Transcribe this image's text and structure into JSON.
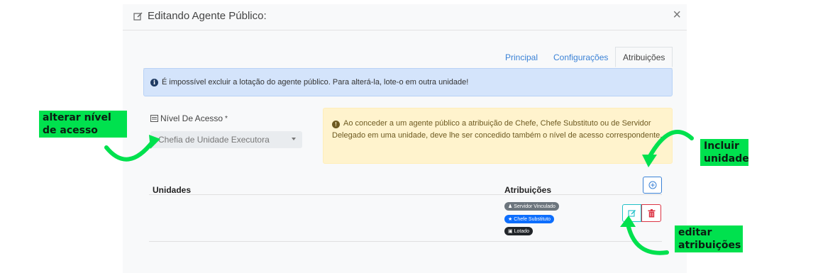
{
  "modal": {
    "title": "Editando Agente Público:",
    "close_icon": "×"
  },
  "tabs": [
    {
      "label": "Principal",
      "active": false
    },
    {
      "label": "Configurações",
      "active": false
    },
    {
      "label": "Atribuições",
      "active": true
    }
  ],
  "info_alert": {
    "icon": "info-circle-icon",
    "text": "É impossível excluir a lotação do agente público. Para alterá-la, lote-o em outra unidade!"
  },
  "access_level": {
    "label": "Nível De Acesso",
    "required_mark": "*",
    "selected_value": "Chefia de Unidade Executora"
  },
  "warning_alert": {
    "icon": "exclamation-circle-icon",
    "text": "Ao conceder a um agente público a atribuição de Chefe, Chefe Substituto ou de Servidor Delegado em uma unidade, deve lhe ser concedido também o nível de acesso correspondente."
  },
  "table": {
    "headers": {
      "units": "Unidades",
      "roles": "Atribuições"
    },
    "rows": [
      {
        "unit": "",
        "badges": [
          {
            "label": "Servidor Vinculado",
            "color": "#6c757d"
          },
          {
            "label": "Chefe Substituto",
            "color": "#0d6efd"
          },
          {
            "label": "Lotado",
            "color": "#212529"
          }
        ]
      }
    ]
  },
  "callouts": {
    "access": "alterar  nível\nde acesso",
    "include": "Incluir\nunidade",
    "edit": "editar\natribuições"
  },
  "colors": {
    "accent": "#3b82d6",
    "callout_green": "#00e14e",
    "edit_teal": "#20c0c8",
    "delete_red": "#dc3545"
  }
}
